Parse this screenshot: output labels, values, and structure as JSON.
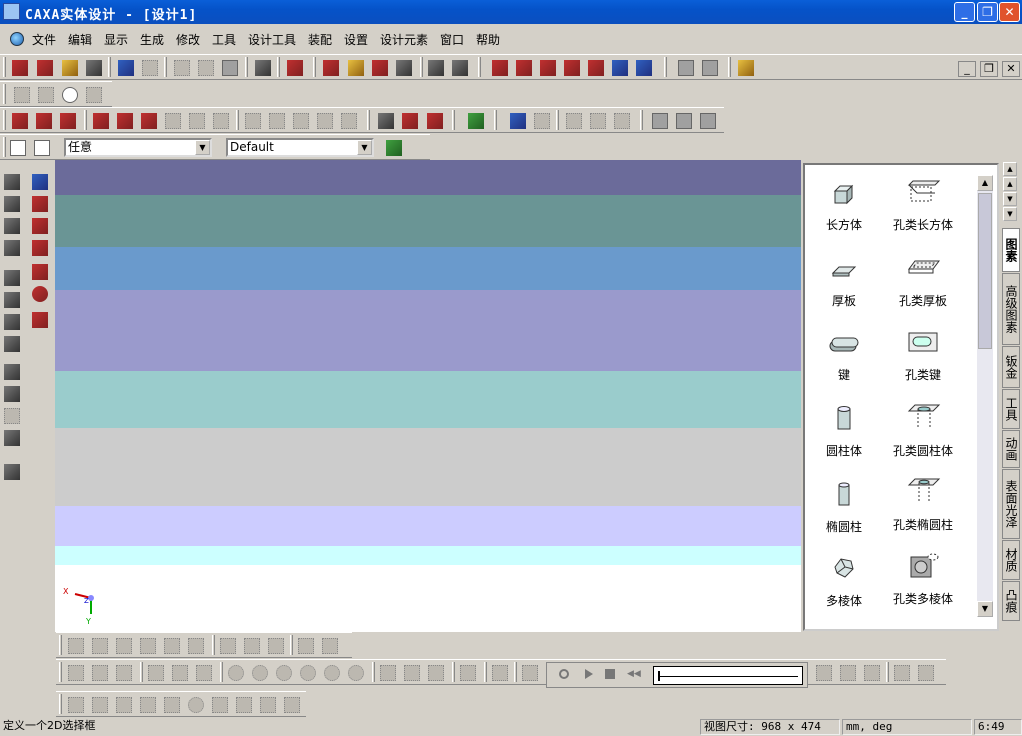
{
  "title": "CAXA实体设计 - [设计1]",
  "menu": [
    "文件",
    "编辑",
    "显示",
    "生成",
    "修改",
    "工具",
    "设计工具",
    "装配",
    "设置",
    "设计元素",
    "窗口",
    "帮助"
  ],
  "combo1": "任意",
  "combo2": "Default",
  "canvas_bands": [
    "#6b6b9a",
    "#6a9595",
    "#6a9acc",
    "#9a9acc",
    "#9acccc",
    "#cccccc",
    "#ccccff",
    "#ccffff",
    "#ffffff"
  ],
  "axes": {
    "x": "X",
    "y": "Y",
    "z": "Z"
  },
  "panel_items": [
    {
      "label": "长方体",
      "icon": "box-icon"
    },
    {
      "label": "孔类长方体",
      "icon": "hole-box-icon"
    },
    {
      "label": "厚板",
      "icon": "slab-icon"
    },
    {
      "label": "孔类厚板",
      "icon": "hole-slab-icon"
    },
    {
      "label": "键",
      "icon": "key-icon"
    },
    {
      "label": "孔类键",
      "icon": "hole-key-icon"
    },
    {
      "label": "圆柱体",
      "icon": "cylinder-icon"
    },
    {
      "label": "孔类圆柱体",
      "icon": "hole-cylinder-icon"
    },
    {
      "label": "椭圆柱",
      "icon": "elliptic-cylinder-icon"
    },
    {
      "label": "孔类椭圆柱",
      "icon": "hole-elliptic-cylinder-icon"
    },
    {
      "label": "多棱体",
      "icon": "polygon-prism-icon"
    },
    {
      "label": "孔类多棱体",
      "icon": "hole-polygon-prism-icon"
    }
  ],
  "tabs": [
    "图素",
    "高级图素",
    "钣金",
    "工具",
    "动画",
    "表面光泽",
    "材质",
    "凸痕"
  ],
  "status": {
    "message": "定义一个2D选择框",
    "view_size_label": "视图尺寸:",
    "view_size": "968 x  474",
    "units": "mm, deg",
    "time": "6:49"
  }
}
